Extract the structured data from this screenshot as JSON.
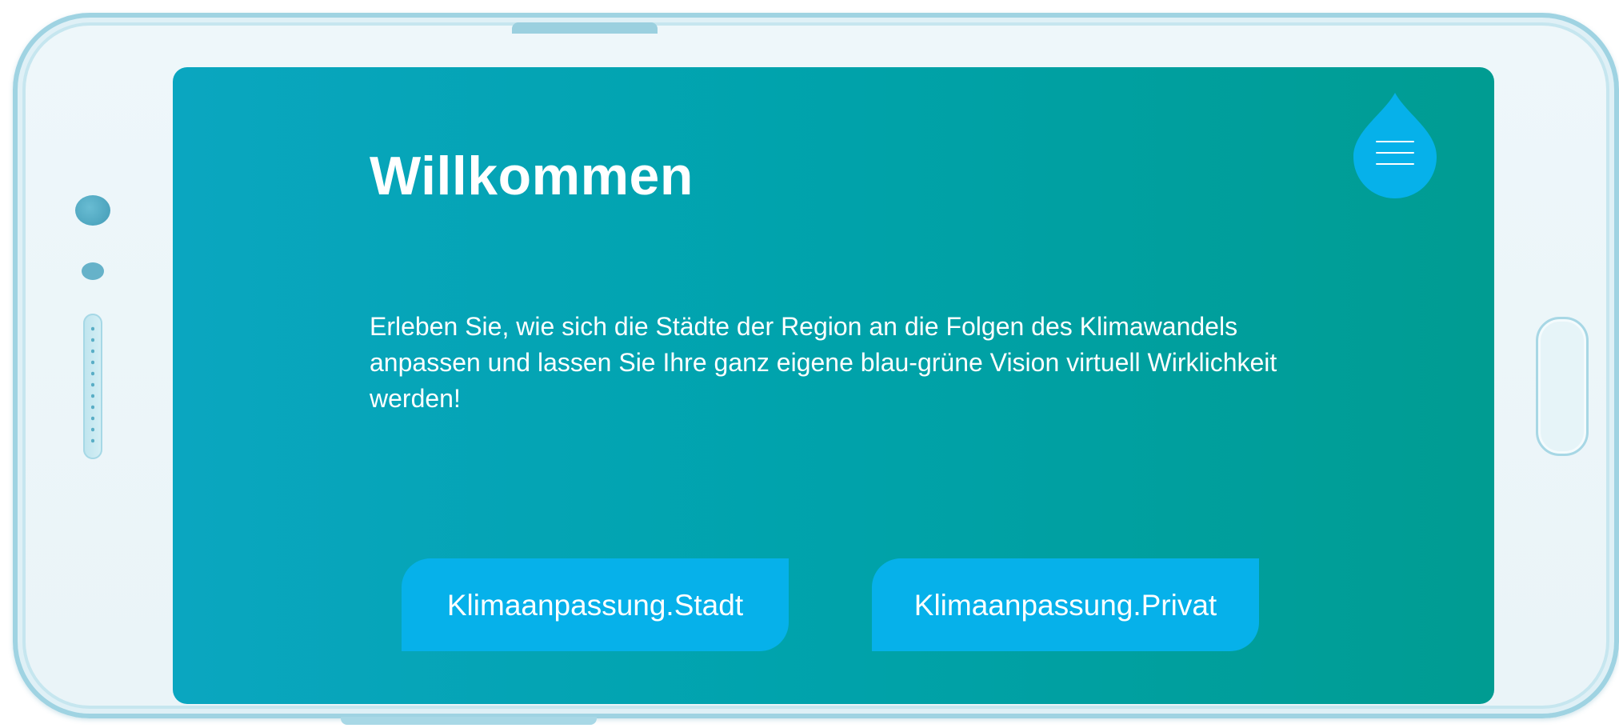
{
  "screen": {
    "title": "Willkommen",
    "intro": "Erleben Sie, wie sich die Städte der Region an die Folgen des Klimawandels anpassen und lassen Sie Ihre ganz eigene blau-grüne Vision virtuell Wirklichkeit werden!",
    "menu_icon": "hamburger-icon",
    "buttons": {
      "stadt_label": "Klimaanpassung.Stadt",
      "privat_label": "Klimaanpassung.Privat"
    }
  },
  "device": {
    "camera_icon": "camera-icon",
    "sensor_icon": "sensor-icon",
    "speaker_icon": "speaker-icon"
  },
  "colors": {
    "screen_gradient_start": "#0aa6c0",
    "screen_gradient_end": "#009c92",
    "button_blue": "#06b1ea",
    "text": "#ffffff",
    "phone_frame": "#9fd3e2"
  }
}
